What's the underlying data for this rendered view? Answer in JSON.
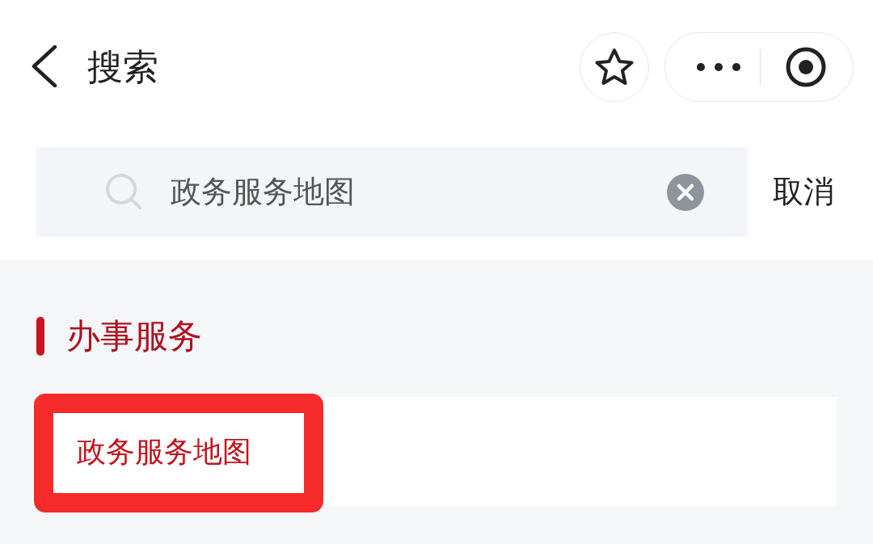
{
  "header": {
    "title": "搜索"
  },
  "search": {
    "value": "政务服务地图",
    "cancel": "取消"
  },
  "section": {
    "title": "办事服务"
  },
  "results": [
    {
      "label": "政务服务地图",
      "highlighted": true
    }
  ]
}
